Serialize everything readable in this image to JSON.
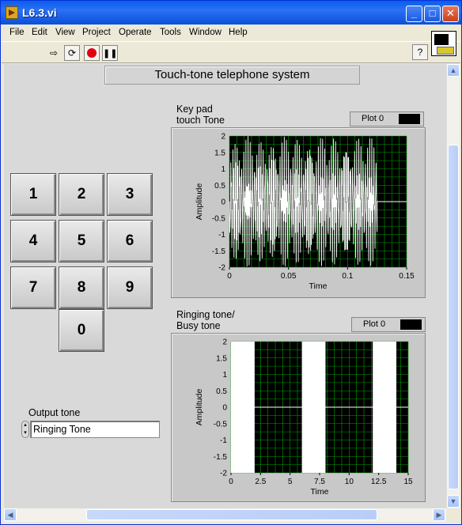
{
  "window": {
    "title": "L6.3.vi",
    "minimize": "_",
    "maximize": "□",
    "close": "✕"
  },
  "menu": [
    "File",
    "Edit",
    "View",
    "Project",
    "Operate",
    "Tools",
    "Window",
    "Help"
  ],
  "toolbar": {
    "run_icon": "run-arrow-icon",
    "run_continuous_icon": "run-continuously-icon",
    "abort_icon": "abort-icon",
    "pause_icon": "pause-icon",
    "help": "?"
  },
  "panel": {
    "heading": "Touch-tone telephone system",
    "keys": [
      "1",
      "2",
      "3",
      "4",
      "5",
      "6",
      "7",
      "8",
      "9",
      "0"
    ],
    "output_tone": {
      "label": "Output tone",
      "value": "Ringing Tone"
    }
  },
  "colors": {
    "plot_bg": "#000000",
    "grid": "#00a000",
    "trace": "#ffffff",
    "panel": "#d9d9d9"
  },
  "chart_data": [
    {
      "type": "line",
      "title": "Key pad\ntouch Tone",
      "legend": "Plot 0",
      "xlabel": "Time",
      "ylabel": "Amplitude",
      "xlim": [
        0,
        0.15
      ],
      "ylim": [
        -2,
        2
      ],
      "xticks": [
        "0",
        "0.05",
        "0.1",
        "0.15"
      ],
      "yticks": [
        "2",
        "1.5",
        "1",
        "0.5",
        "0",
        "-0.5",
        "-1",
        "-1.5",
        "-2"
      ],
      "series": [
        {
          "name": "Plot 0",
          "signal": "dual-tone burst",
          "x_start": 0,
          "x_end": 0.125,
          "amplitude": 2
        }
      ]
    },
    {
      "type": "line",
      "title": "Ringing tone/\nBusy tone",
      "legend": "Plot 0",
      "xlabel": "Time",
      "ylabel": "Amplitude",
      "xlim": [
        0,
        15
      ],
      "ylim": [
        -2,
        2
      ],
      "xticks": [
        "0",
        "2.5",
        "5",
        "7.5",
        "10",
        "12.5",
        "15"
      ],
      "yticks": [
        "2",
        "1.5",
        "1",
        "0.5",
        "0",
        "-0.5",
        "-1",
        "-1.5",
        "-2"
      ],
      "series": [
        {
          "name": "Plot 0",
          "signal": "bursts",
          "bursts": [
            [
              0,
              2
            ],
            [
              6,
              8
            ],
            [
              12,
              14
            ]
          ],
          "amplitude": 2
        }
      ]
    }
  ]
}
